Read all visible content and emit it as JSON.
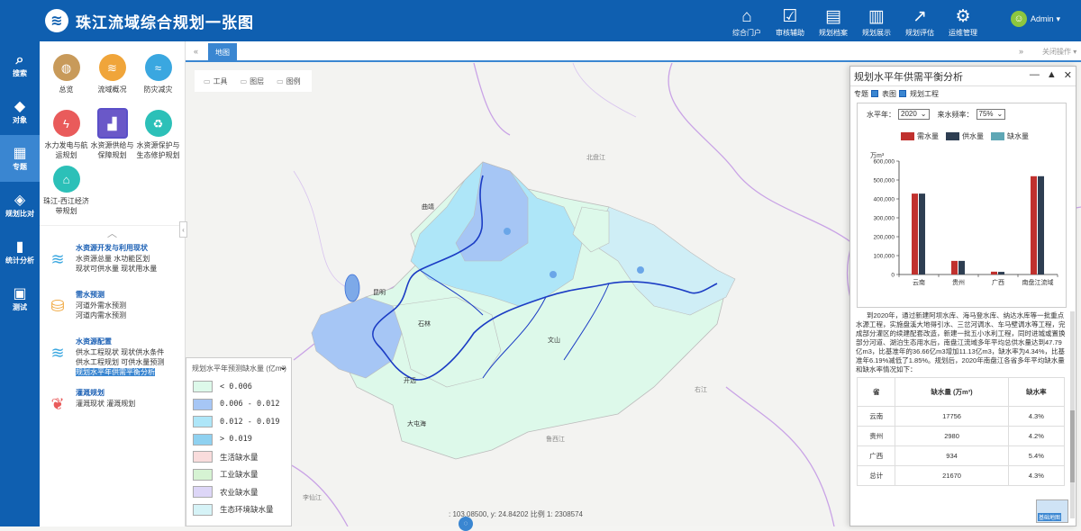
{
  "app": {
    "title": "珠江流域综合规划一张图",
    "logo_icon": "water-drop-logo-icon"
  },
  "topnav": [
    {
      "label": "综合门户",
      "icon": "home-icon",
      "glyph": "⌂"
    },
    {
      "label": "审核辅助",
      "icon": "audit-icon",
      "glyph": "☑"
    },
    {
      "label": "规划档案",
      "icon": "archive-icon",
      "glyph": "▤"
    },
    {
      "label": "规划展示",
      "icon": "display-icon",
      "glyph": "▥"
    },
    {
      "label": "规划评估",
      "icon": "evaluate-icon",
      "glyph": "↗"
    },
    {
      "label": "运维管理",
      "icon": "settings-gear-icon",
      "glyph": "⚙"
    }
  ],
  "user": {
    "name": "Admin",
    "caret": "▾"
  },
  "sidenav": [
    {
      "label": "搜索",
      "glyph": "⌕",
      "icon": "search-icon"
    },
    {
      "label": "对象",
      "glyph": "◆",
      "icon": "object-drops-icon"
    },
    {
      "label": "专题",
      "glyph": "▦",
      "icon": "thematic-grid-icon",
      "active": true
    },
    {
      "label": "规划比对",
      "glyph": "◈",
      "icon": "layers-compare-icon"
    },
    {
      "label": "统计分析",
      "glyph": "▮",
      "icon": "statistics-bar-icon"
    },
    {
      "label": "测试",
      "glyph": "▣",
      "icon": "test-screen-icon"
    }
  ],
  "panel": {
    "topics": [
      {
        "label": "总览",
        "color": "#c89a5a",
        "glyph": "◍"
      },
      {
        "label": "流域概况",
        "color": "#f0a53a",
        "glyph": "≋"
      },
      {
        "label": "防灾减灾",
        "color": "#3aa7e0",
        "glyph": "≈"
      },
      {
        "label": "水力发电与航运规划",
        "color": "#e95b5b",
        "glyph": "ϟ"
      },
      {
        "label": "水资源供给与保障规划",
        "color": "#6a58c8",
        "glyph": "▟",
        "selected": true
      },
      {
        "label": "水资源保护与生态修护规划",
        "color": "#2cc0b8",
        "glyph": "♻"
      },
      {
        "label": "珠江-西江经济带规划",
        "color": "#2cc0b8",
        "glyph": "⌂"
      }
    ],
    "collapse_glyph": "︿",
    "sections": [
      {
        "title": "水资源开发与利用现状",
        "lines": [
          "水资源总量 水功能区划",
          "现状可供水量 现状用水量"
        ],
        "glyph": "≋",
        "color": "#3aa7e0"
      },
      {
        "title": "需水预测",
        "lines": [
          "河道外需水预测",
          "河道内需水预测"
        ],
        "glyph": "⛁",
        "color": "#f0a53a"
      },
      {
        "title": "水资源配置",
        "lines": [
          "供水工程现状 现状供水条件",
          "供水工程规划 可供水量预测"
        ],
        "highlight": "规划水平年供需平衡分析",
        "glyph": "≋",
        "color": "#3aa7e0"
      },
      {
        "title": "灌溉规划",
        "lines": [
          "灌溉现状 灌溉规划"
        ],
        "glyph": "❦",
        "color": "#e95b5b"
      }
    ],
    "toggle_glyph": "‹"
  },
  "tabs": {
    "prev": "«",
    "active": "地图",
    "next": "»",
    "close": "关闭操作 ▾"
  },
  "toolbar": [
    {
      "label": "工具",
      "icon": "toolbox-icon"
    },
    {
      "label": "图层",
      "icon": "layers-icon"
    },
    {
      "label": "图例",
      "icon": "legend-icon"
    }
  ],
  "map_labels": [
    {
      "text": "北盘江",
      "color": "#888"
    },
    {
      "text": "右江",
      "color": "#888"
    },
    {
      "text": "鲁西江",
      "color": "#888"
    },
    {
      "text": "李仙江",
      "color": "#888"
    },
    {
      "text": "曲靖",
      "color": "#333"
    },
    {
      "text": "昆明",
      "color": "#333"
    },
    {
      "text": "石林",
      "color": "#333"
    },
    {
      "text": "开远",
      "color": "#333"
    },
    {
      "text": "文山",
      "color": "#333"
    },
    {
      "text": "大屯海",
      "color": "#333"
    }
  ],
  "legend": {
    "title": "规划水平年预测缺水量 (亿m³)",
    "dropdown": "⌄",
    "items": [
      {
        "label": "< 0.006",
        "color": "#ddf9ea"
      },
      {
        "label": "0.006 - 0.012",
        "color": "#a6c6f5"
      },
      {
        "label": "0.012 - 0.019",
        "color": "#aee6f8"
      },
      {
        "label": "> 0.019",
        "color": "#8fd1f0"
      },
      {
        "label": "生活缺水量",
        "color": "#f9dcdc"
      },
      {
        "label": "工业缺水量",
        "color": "#d6f3d3"
      },
      {
        "label": "农业缺水量",
        "color": "#ddd6f7"
      },
      {
        "label": "生态环境缺水量",
        "color": "#d6f3f7"
      }
    ]
  },
  "coords": ": 103.08500, y: 24.84202 比例 1: 2308574",
  "marker_glyph": "◌",
  "analysis": {
    "title": "规划水平年供需平衡分析",
    "controls": [
      "—",
      "▲",
      "✕"
    ],
    "opts": {
      "label": "专题",
      "cb1": "表图",
      "cb2": "规划工程"
    },
    "filters": {
      "year_label": "水平年：",
      "year": "2020",
      "freq_label": "来水频率：",
      "freq": "75%",
      "caret": "⌄"
    },
    "text": "到2020年，通过新建阿坝水库、海马登水库、纳达水库等一批重点水源工程，实施盘溪大地得引水、三岔河调水、车马壁调水等工程，完成部分灌区的续建配套改造，新建一批五小水利工程，同时进城或置换部分河道、湖泊生态用水后，南盘江流域多年平均总供水量达到47.79亿m3，比基准年的36.66亿m3增加11.13亿m3，缺水率为4.34%，比基准年6.19%减低了1.85%。规划后，2020年南盘江各省多年平均缺水量和缺水率情况如下：",
    "table": {
      "headers": [
        "省",
        "缺水量 (万m³)",
        "缺水率"
      ],
      "rows": [
        [
          "云南",
          "17756",
          "4.3%"
        ],
        [
          "贵州",
          "2980",
          "4.2%"
        ],
        [
          "广西",
          "934",
          "5.4%"
        ],
        [
          "总计",
          "21670",
          "4.3%"
        ]
      ]
    }
  },
  "overview_label": "基础地图",
  "chart_data": {
    "type": "bar",
    "title": "",
    "ylabel": "万m³",
    "xlabel": "",
    "categories": [
      "云南",
      "贵州",
      "广西",
      "南盘江流域"
    ],
    "series": [
      {
        "name": "需水量",
        "color": "#c0312e",
        "values": [
          428000,
          72000,
          15000,
          520000
        ]
      },
      {
        "name": "供水量",
        "color": "#2e3e52",
        "values": [
          428000,
          72000,
          14000,
          520000
        ]
      },
      {
        "name": "缺水量",
        "color": "#5fa7b5",
        "values": [
          0,
          0,
          0,
          0
        ]
      }
    ],
    "ylim": [
      0,
      600000
    ],
    "yticks": [
      "0",
      "100,000",
      "200,000",
      "300,000",
      "400,000",
      "500,000",
      "600,000"
    ],
    "grid": false,
    "legend_position": "top"
  }
}
